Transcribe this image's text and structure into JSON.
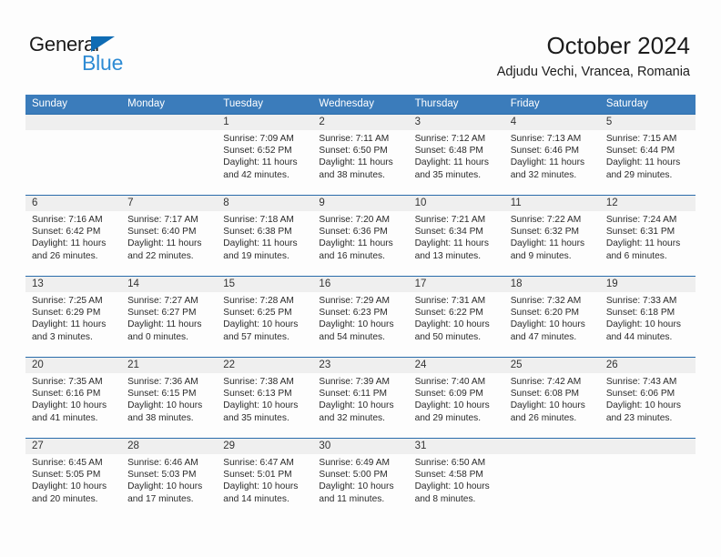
{
  "brand": {
    "name_top": "General",
    "name_bottom": "Blue",
    "triangle_icon": "triangle-icon",
    "accent_color": "#0f6cb4",
    "secondary_color": "#2e8bd4"
  },
  "header": {
    "title": "October 2024",
    "subtitle": "Adjudu Vechi, Vrancea, Romania"
  },
  "calendar": {
    "header_bg": "#3b7cbb",
    "row_rule_color": "#2a6cab",
    "daynum_band_color": "#efefef",
    "weekdays": [
      "Sunday",
      "Monday",
      "Tuesday",
      "Wednesday",
      "Thursday",
      "Friday",
      "Saturday"
    ],
    "weeks": [
      [
        {
          "day": ""
        },
        {
          "day": ""
        },
        {
          "day": "1",
          "sunrise": "Sunrise: 7:09 AM",
          "sunset": "Sunset: 6:52 PM",
          "daylight1": "Daylight: 11 hours",
          "daylight2": "and 42 minutes."
        },
        {
          "day": "2",
          "sunrise": "Sunrise: 7:11 AM",
          "sunset": "Sunset: 6:50 PM",
          "daylight1": "Daylight: 11 hours",
          "daylight2": "and 38 minutes."
        },
        {
          "day": "3",
          "sunrise": "Sunrise: 7:12 AM",
          "sunset": "Sunset: 6:48 PM",
          "daylight1": "Daylight: 11 hours",
          "daylight2": "and 35 minutes."
        },
        {
          "day": "4",
          "sunrise": "Sunrise: 7:13 AM",
          "sunset": "Sunset: 6:46 PM",
          "daylight1": "Daylight: 11 hours",
          "daylight2": "and 32 minutes."
        },
        {
          "day": "5",
          "sunrise": "Sunrise: 7:15 AM",
          "sunset": "Sunset: 6:44 PM",
          "daylight1": "Daylight: 11 hours",
          "daylight2": "and 29 minutes."
        }
      ],
      [
        {
          "day": "6",
          "sunrise": "Sunrise: 7:16 AM",
          "sunset": "Sunset: 6:42 PM",
          "daylight1": "Daylight: 11 hours",
          "daylight2": "and 26 minutes."
        },
        {
          "day": "7",
          "sunrise": "Sunrise: 7:17 AM",
          "sunset": "Sunset: 6:40 PM",
          "daylight1": "Daylight: 11 hours",
          "daylight2": "and 22 minutes."
        },
        {
          "day": "8",
          "sunrise": "Sunrise: 7:18 AM",
          "sunset": "Sunset: 6:38 PM",
          "daylight1": "Daylight: 11 hours",
          "daylight2": "and 19 minutes."
        },
        {
          "day": "9",
          "sunrise": "Sunrise: 7:20 AM",
          "sunset": "Sunset: 6:36 PM",
          "daylight1": "Daylight: 11 hours",
          "daylight2": "and 16 minutes."
        },
        {
          "day": "10",
          "sunrise": "Sunrise: 7:21 AM",
          "sunset": "Sunset: 6:34 PM",
          "daylight1": "Daylight: 11 hours",
          "daylight2": "and 13 minutes."
        },
        {
          "day": "11",
          "sunrise": "Sunrise: 7:22 AM",
          "sunset": "Sunset: 6:32 PM",
          "daylight1": "Daylight: 11 hours",
          "daylight2": "and 9 minutes."
        },
        {
          "day": "12",
          "sunrise": "Sunrise: 7:24 AM",
          "sunset": "Sunset: 6:31 PM",
          "daylight1": "Daylight: 11 hours",
          "daylight2": "and 6 minutes."
        }
      ],
      [
        {
          "day": "13",
          "sunrise": "Sunrise: 7:25 AM",
          "sunset": "Sunset: 6:29 PM",
          "daylight1": "Daylight: 11 hours",
          "daylight2": "and 3 minutes."
        },
        {
          "day": "14",
          "sunrise": "Sunrise: 7:27 AM",
          "sunset": "Sunset: 6:27 PM",
          "daylight1": "Daylight: 11 hours",
          "daylight2": "and 0 minutes."
        },
        {
          "day": "15",
          "sunrise": "Sunrise: 7:28 AM",
          "sunset": "Sunset: 6:25 PM",
          "daylight1": "Daylight: 10 hours",
          "daylight2": "and 57 minutes."
        },
        {
          "day": "16",
          "sunrise": "Sunrise: 7:29 AM",
          "sunset": "Sunset: 6:23 PM",
          "daylight1": "Daylight: 10 hours",
          "daylight2": "and 54 minutes."
        },
        {
          "day": "17",
          "sunrise": "Sunrise: 7:31 AM",
          "sunset": "Sunset: 6:22 PM",
          "daylight1": "Daylight: 10 hours",
          "daylight2": "and 50 minutes."
        },
        {
          "day": "18",
          "sunrise": "Sunrise: 7:32 AM",
          "sunset": "Sunset: 6:20 PM",
          "daylight1": "Daylight: 10 hours",
          "daylight2": "and 47 minutes."
        },
        {
          "day": "19",
          "sunrise": "Sunrise: 7:33 AM",
          "sunset": "Sunset: 6:18 PM",
          "daylight1": "Daylight: 10 hours",
          "daylight2": "and 44 minutes."
        }
      ],
      [
        {
          "day": "20",
          "sunrise": "Sunrise: 7:35 AM",
          "sunset": "Sunset: 6:16 PM",
          "daylight1": "Daylight: 10 hours",
          "daylight2": "and 41 minutes."
        },
        {
          "day": "21",
          "sunrise": "Sunrise: 7:36 AM",
          "sunset": "Sunset: 6:15 PM",
          "daylight1": "Daylight: 10 hours",
          "daylight2": "and 38 minutes."
        },
        {
          "day": "22",
          "sunrise": "Sunrise: 7:38 AM",
          "sunset": "Sunset: 6:13 PM",
          "daylight1": "Daylight: 10 hours",
          "daylight2": "and 35 minutes."
        },
        {
          "day": "23",
          "sunrise": "Sunrise: 7:39 AM",
          "sunset": "Sunset: 6:11 PM",
          "daylight1": "Daylight: 10 hours",
          "daylight2": "and 32 minutes."
        },
        {
          "day": "24",
          "sunrise": "Sunrise: 7:40 AM",
          "sunset": "Sunset: 6:09 PM",
          "daylight1": "Daylight: 10 hours",
          "daylight2": "and 29 minutes."
        },
        {
          "day": "25",
          "sunrise": "Sunrise: 7:42 AM",
          "sunset": "Sunset: 6:08 PM",
          "daylight1": "Daylight: 10 hours",
          "daylight2": "and 26 minutes."
        },
        {
          "day": "26",
          "sunrise": "Sunrise: 7:43 AM",
          "sunset": "Sunset: 6:06 PM",
          "daylight1": "Daylight: 10 hours",
          "daylight2": "and 23 minutes."
        }
      ],
      [
        {
          "day": "27",
          "sunrise": "Sunrise: 6:45 AM",
          "sunset": "Sunset: 5:05 PM",
          "daylight1": "Daylight: 10 hours",
          "daylight2": "and 20 minutes."
        },
        {
          "day": "28",
          "sunrise": "Sunrise: 6:46 AM",
          "sunset": "Sunset: 5:03 PM",
          "daylight1": "Daylight: 10 hours",
          "daylight2": "and 17 minutes."
        },
        {
          "day": "29",
          "sunrise": "Sunrise: 6:47 AM",
          "sunset": "Sunset: 5:01 PM",
          "daylight1": "Daylight: 10 hours",
          "daylight2": "and 14 minutes."
        },
        {
          "day": "30",
          "sunrise": "Sunrise: 6:49 AM",
          "sunset": "Sunset: 5:00 PM",
          "daylight1": "Daylight: 10 hours",
          "daylight2": "and 11 minutes."
        },
        {
          "day": "31",
          "sunrise": "Sunrise: 6:50 AM",
          "sunset": "Sunset: 4:58 PM",
          "daylight1": "Daylight: 10 hours",
          "daylight2": "and 8 minutes."
        },
        {
          "day": ""
        },
        {
          "day": ""
        }
      ]
    ]
  }
}
